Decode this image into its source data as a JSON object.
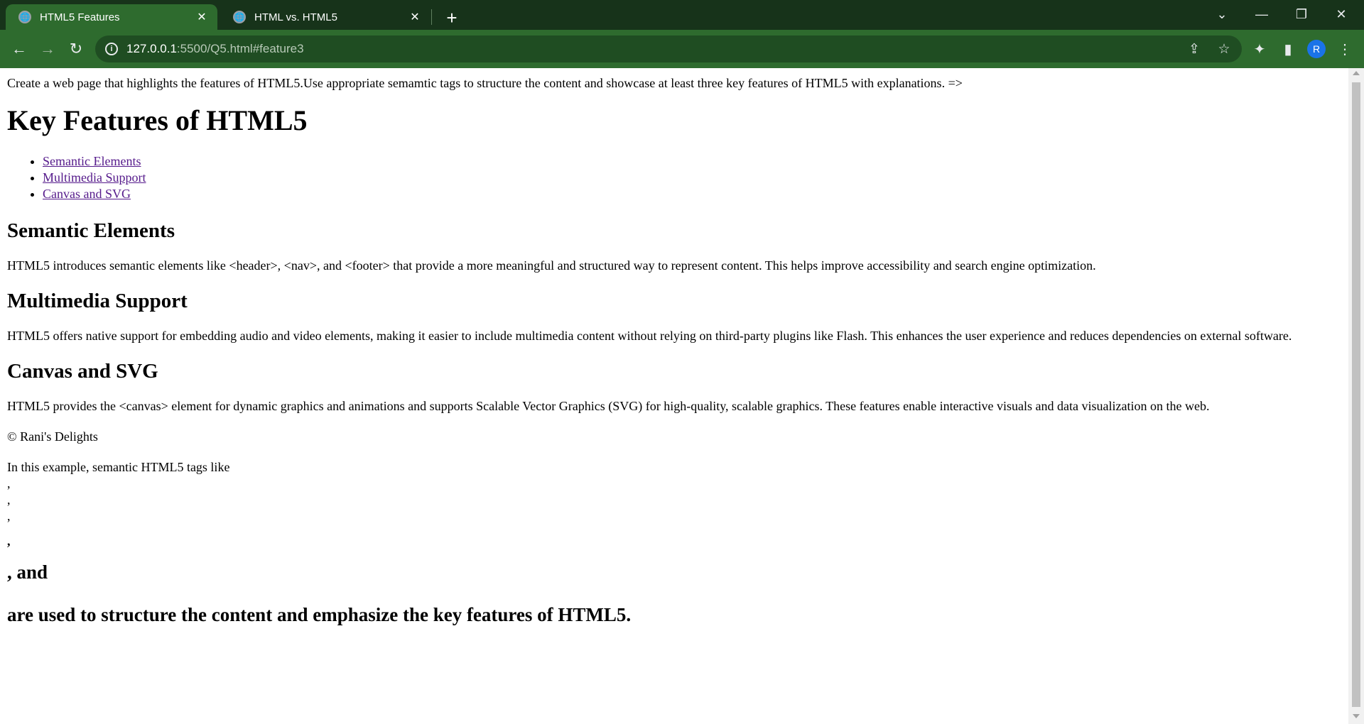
{
  "browser": {
    "tabs": [
      {
        "title": "HTML5 Features",
        "active": true
      },
      {
        "title": "HTML vs. HTML5",
        "active": false
      }
    ],
    "url_host": "127.0.0.1",
    "url_path": ":5500/Q5.html#feature3",
    "avatar_initial": "R",
    "colors": {
      "frame": "#17331a",
      "toolbar": "#2e6b2e",
      "omnibox": "#1f4d22"
    }
  },
  "page": {
    "intro": "Create a web page that highlights the features of HTML5.Use appropriate semamtic tags to structure the content and showcase at least three key features of HTML5 with explanations. =>",
    "heading": "Key Features of HTML5",
    "nav_links": [
      "Semantic Elements",
      "Multimedia Support",
      "Canvas and SVG"
    ],
    "sections": [
      {
        "title": "Semantic Elements",
        "text": "HTML5 introduces semantic elements like <header>, <nav>, and <footer> that provide a more meaningful and structured way to represent content. This helps improve accessibility and search engine optimization."
      },
      {
        "title": "Multimedia Support",
        "text": "HTML5 offers native support for embedding audio and video elements, making it easier to include multimedia content without relying on third-party plugins like Flash. This enhances the user experience and reduces dependencies on external software."
      },
      {
        "title": "Canvas and SVG",
        "text": "HTML5 provides the <canvas> element for dynamic graphics and animations and supports Scalable Vector Graphics (SVG) for high-quality, scalable graphics. These features enable interactive visuals and data visualization on the web."
      }
    ],
    "footer": "© Rani's Delights",
    "example_line": "In this example, semantic HTML5 tags like",
    "comma": ",",
    "and_line": ", and",
    "final_line": "are used to structure the content and emphasize the key features of HTML5."
  }
}
